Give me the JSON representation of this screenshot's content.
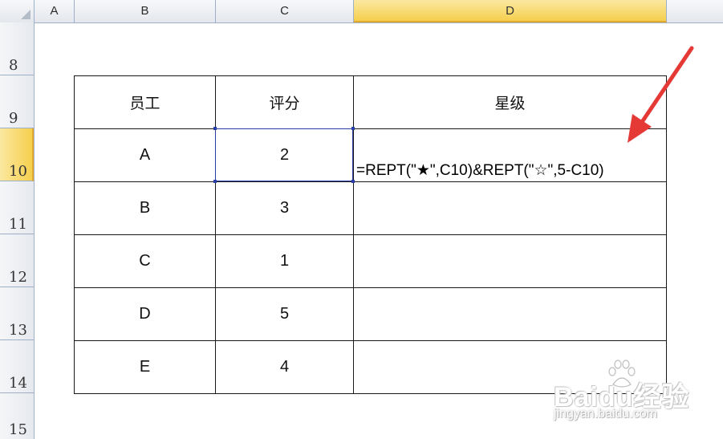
{
  "columns": {
    "a": "A",
    "b": "B",
    "c": "C",
    "d": "D",
    "active": "D"
  },
  "rows": {
    "r8": "8",
    "r9": "9",
    "r10": "10",
    "r11": "11",
    "r12": "12",
    "r13": "13",
    "r14": "14",
    "r15": "15",
    "active": "10"
  },
  "table": {
    "headers": [
      "员工",
      "评分",
      "星级"
    ],
    "rows": [
      {
        "employee": "A",
        "score": "2",
        "stars": "=REPT(\"★\",C10)&REPT(\"☆\",5-C10)"
      },
      {
        "employee": "B",
        "score": "3",
        "stars": ""
      },
      {
        "employee": "C",
        "score": "1",
        "stars": ""
      },
      {
        "employee": "D",
        "score": "5",
        "stars": ""
      },
      {
        "employee": "E",
        "score": "4",
        "stars": ""
      }
    ]
  },
  "watermark": {
    "brand": "Baidu经验",
    "url": "jingyan.baidu.com"
  },
  "colors": {
    "arrow": "#e53935",
    "selection": "#2a3fa8",
    "active_header": "#f5cf4e"
  },
  "icons": {
    "select_all": "select-all-triangle-icon",
    "annotation": "red-arrow-annotation"
  }
}
